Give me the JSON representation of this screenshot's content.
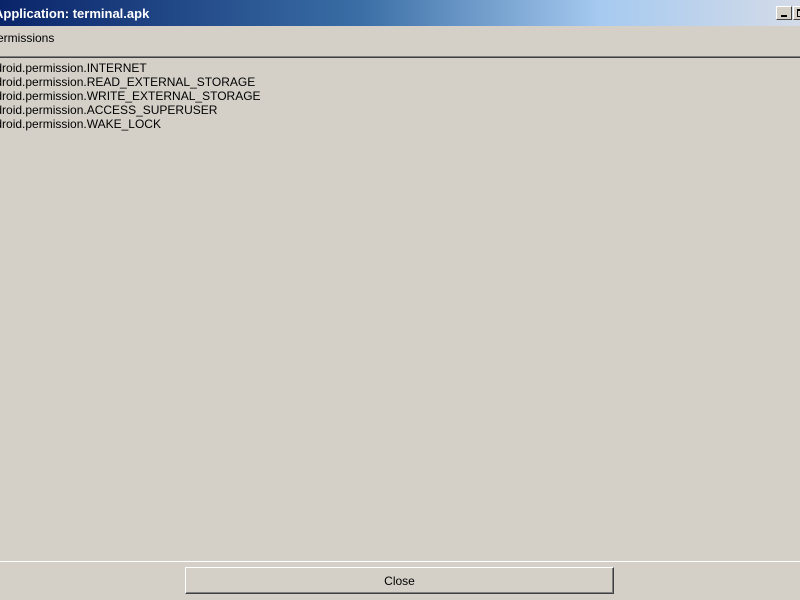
{
  "window": {
    "title": "Application: terminal.apk"
  },
  "permissions": {
    "label": "Permissions",
    "items": [
      "android.permission.INTERNET",
      "android.permission.READ_EXTERNAL_STORAGE",
      "android.permission.WRITE_EXTERNAL_STORAGE",
      "android.permission.ACCESS_SUPERUSER",
      "android.permission.WAKE_LOCK"
    ]
  },
  "footer": {
    "close_label": "Close"
  }
}
